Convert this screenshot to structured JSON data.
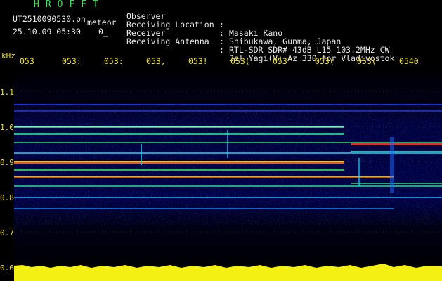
{
  "header": {
    "app_title": "HROFFT",
    "filename": "UT2510090530.pn",
    "mode": "meteor",
    "datetime": "25.10.09 05:30",
    "zero": "0_"
  },
  "info": [
    {
      "key": "Observer",
      "sep": ":",
      "value": "Masaki Kano"
    },
    {
      "key": "Receiving Location",
      "sep": ":",
      "value": "Shibukawa, Gunma, Japan"
    },
    {
      "key": "Receiver",
      "sep": ":",
      "value": "RTL-SDR SDR# 43dB L15 103.2MHz CW"
    },
    {
      "key": "Receiving Antenna",
      "sep": ":",
      "value": "3el Yagi(V) Az 330 for Vladivostok"
    }
  ],
  "axis": {
    "unit": "kHz",
    "x_ticks": [
      "053",
      "053:",
      "053:",
      "053,",
      "053!",
      "053(",
      "053'",
      "053(",
      "053(",
      "0540"
    ],
    "y_ticks": [
      "1.1",
      "1.0",
      "0.9",
      "0.8",
      "0.7",
      "0.6"
    ]
  },
  "colors": {
    "label_green": "#2ee64a",
    "label_white": "#e9e9e9",
    "axis_yellow": "#f2e21a",
    "background_dark_blue": "#000033",
    "signal_red": "#ff2020"
  }
}
